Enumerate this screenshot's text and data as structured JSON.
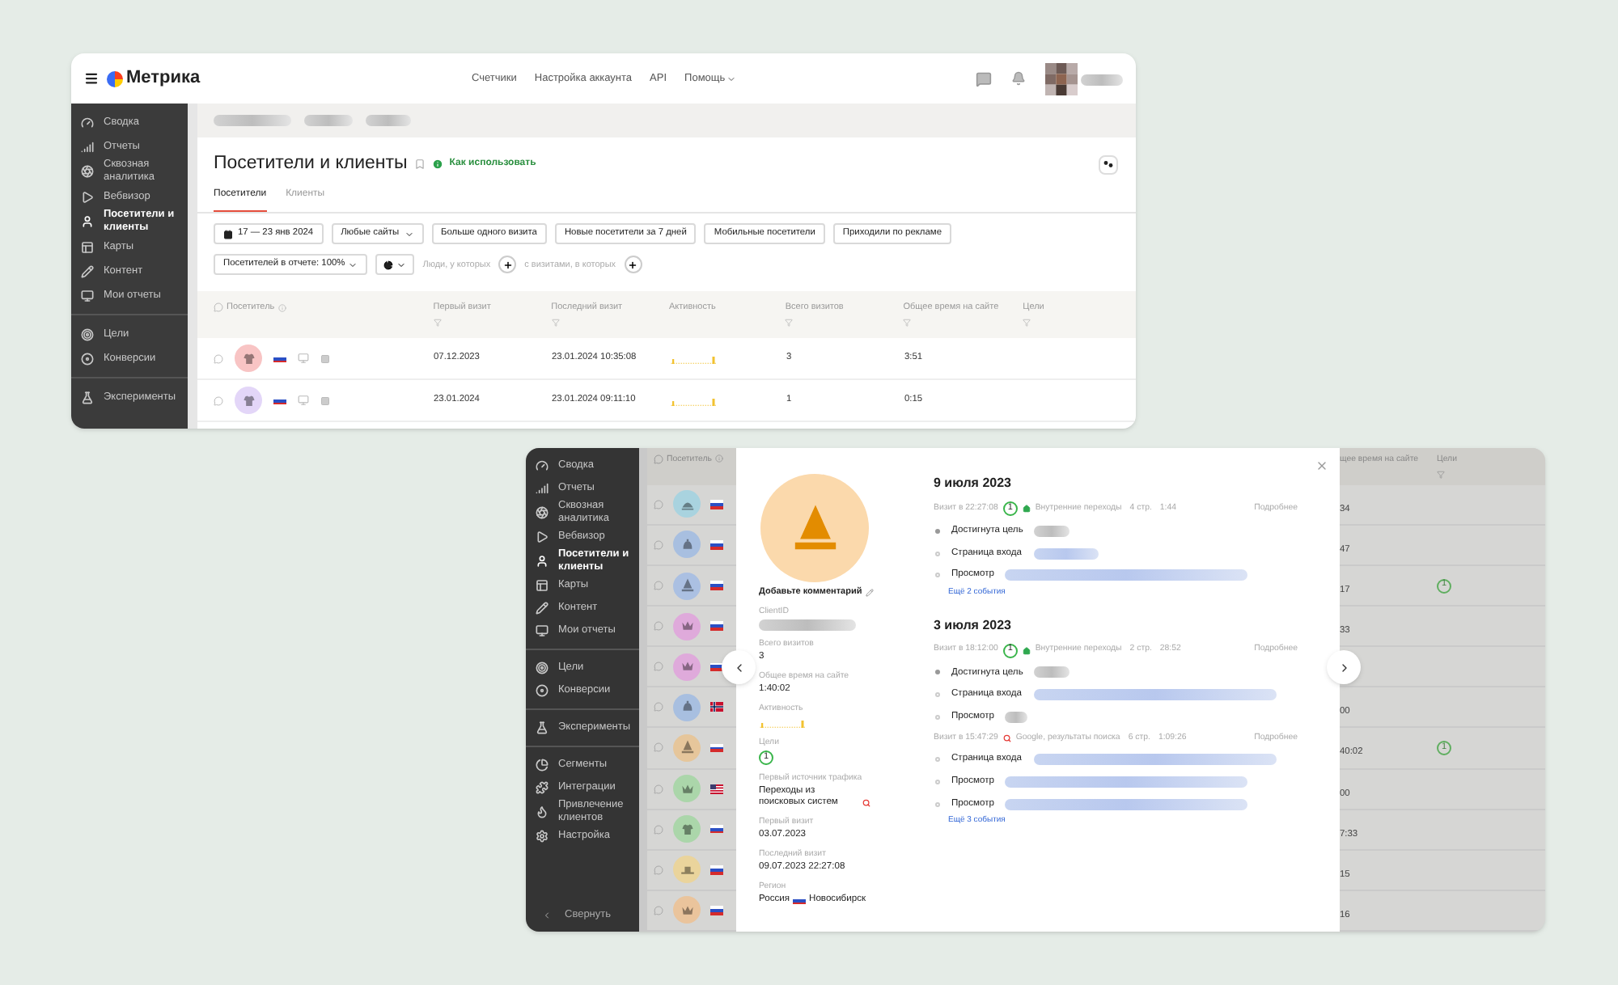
{
  "top_window": {
    "header": {
      "logo": "Метрика",
      "nav": [
        {
          "label": "Счетчики",
          "dropdown": false
        },
        {
          "label": "Настройка аккаунта",
          "dropdown": false
        },
        {
          "label": "API",
          "dropdown": false
        },
        {
          "label": "Помощь",
          "dropdown": true
        }
      ]
    },
    "sidebar": {
      "items": [
        {
          "label": "Сводка",
          "selected": false
        },
        {
          "label": "Отчеты",
          "selected": false
        },
        {
          "label": "Сквозная аналитика",
          "selected": false
        },
        {
          "label": "Вебвизор",
          "selected": false
        },
        {
          "label": "Посетители и клиенты",
          "selected": true
        },
        {
          "label": "Карты",
          "selected": false
        },
        {
          "label": "Контент",
          "selected": false
        },
        {
          "label": "Мои отчеты",
          "selected": false
        },
        {
          "label": "Цели",
          "selected": false
        },
        {
          "label": "Конверсии",
          "selected": false
        },
        {
          "label": "Эксперименты",
          "selected": false
        }
      ]
    },
    "page": {
      "title": "Посетители и клиенты",
      "help_link": "Как использовать",
      "tabs": [
        {
          "label": "Посетители",
          "selected": true
        },
        {
          "label": "Клиенты",
          "selected": false
        }
      ],
      "filters": [
        {
          "label": "17 — 23 янв 2024",
          "kind": "date"
        },
        {
          "label": "Любые сайты",
          "kind": "dropdown"
        },
        {
          "label": "Больше одного визита",
          "kind": "button"
        },
        {
          "label": "Новые посетители за 7 дней",
          "kind": "button"
        },
        {
          "label": "Мобильные посетители",
          "kind": "button"
        },
        {
          "label": "Приходили по рекламе",
          "kind": "button"
        }
      ],
      "sampling": "Посетителей в отчете: 100%",
      "condition_people": "Люди, у которых",
      "condition_visits": "с визитами, в которых"
    },
    "table": {
      "columns": [
        "Посетитель",
        "Первый визит",
        "Последний визит",
        "Активность",
        "Всего визитов",
        "Общее время на сайте",
        "Цели"
      ],
      "rows": [
        {
          "avatar": {
            "kind": "shirt",
            "color": "#f8c4c4"
          },
          "flag": {
            "kind": "ru"
          },
          "first_visit": "07.12.2023",
          "last_visit": "23.01.2024 10:35:08",
          "visits": "3",
          "time": "3:51"
        },
        {
          "avatar": {
            "kind": "shirt",
            "color": "#e3d6f8"
          },
          "flag": {
            "kind": "ru"
          },
          "first_visit": "23.01.2024",
          "last_visit": "23.01.2024 09:11:10",
          "visits": "1",
          "time": "0:15"
        }
      ]
    }
  },
  "bottom_window": {
    "sidebar": {
      "items": [
        {
          "label": "Сводка",
          "selected": false
        },
        {
          "label": "Отчеты",
          "selected": false
        },
        {
          "label": "Сквозная аналитика",
          "selected": false
        },
        {
          "label": "Вебвизор",
          "selected": false
        },
        {
          "label": "Посетители и клиенты",
          "selected": true
        },
        {
          "label": "Карты",
          "selected": false
        },
        {
          "label": "Контент",
          "selected": false
        },
        {
          "label": "Мои отчеты",
          "selected": false
        },
        {
          "label": "Цели",
          "selected": false
        },
        {
          "label": "Конверсии",
          "selected": false
        },
        {
          "label": "Эксперименты",
          "selected": false
        },
        {
          "label": "Сегменты",
          "selected": false
        },
        {
          "label": "Интеграции",
          "selected": false
        },
        {
          "label": "Привлечение клиентов",
          "selected": false
        },
        {
          "label": "Настройка",
          "selected": false
        }
      ],
      "collapse": "Свернуть"
    },
    "table": {
      "visitor_column": "Посетитель",
      "time_column": "щее время на сайте",
      "goals_column": "Цели",
      "rows": [
        {
          "avatar": {
            "kind": "cap",
            "color": "#a9d3df"
          },
          "flag": {
            "kind": "ru"
          },
          "time": "34"
        },
        {
          "avatar": {
            "kind": "bell",
            "color": "#a8bfe0"
          },
          "flag": {
            "kind": "ru"
          },
          "time": "47"
        },
        {
          "avatar": {
            "kind": "cone",
            "color": "#abc0e2"
          },
          "flag": {
            "kind": "ru"
          },
          "time": "17",
          "goals": "1"
        },
        {
          "avatar": {
            "kind": "crown",
            "color": "#dfaadb"
          },
          "flag": {
            "kind": "ru"
          },
          "time": "33"
        },
        {
          "avatar": {
            "kind": "crown",
            "color": "#dfaadb"
          },
          "flag": {
            "kind": "ru"
          }
        },
        {
          "avatar": {
            "kind": "bell",
            "color": "#a8bfe0"
          },
          "flag": {
            "kind": "no"
          },
          "time": "00"
        },
        {
          "avatar": {
            "kind": "cone",
            "color": "#e6c69b"
          },
          "flag": {
            "kind": "ru"
          },
          "time": "40:02",
          "goals": "1"
        },
        {
          "avatar": {
            "kind": "crown",
            "color": "#abd6aa"
          },
          "flag": {
            "kind": "us"
          },
          "time": "00"
        },
        {
          "avatar": {
            "kind": "shirt",
            "color": "#abd6aa"
          },
          "flag": {
            "kind": "ru"
          },
          "time": "7:33"
        },
        {
          "avatar": {
            "kind": "hat",
            "color": "#ead49c"
          },
          "flag": {
            "kind": "ru"
          },
          "time": "15"
        },
        {
          "avatar": {
            "kind": "crown",
            "color": "#eac49c"
          },
          "flag": {
            "kind": "ru"
          },
          "time": "16"
        }
      ]
    },
    "visitor_card": {
      "avatar": {
        "kind": "cone",
        "color": "#fbd9ac"
      },
      "comment": "Добавьте комментарий",
      "fields": [
        {
          "label": "ClientID",
          "kind": "blurred"
        },
        {
          "label": "Всего визитов",
          "value": "3",
          "kind": "text"
        },
        {
          "label": "Общее время на сайте",
          "value": "1:40:02",
          "kind": "text"
        },
        {
          "label": "Активность",
          "kind": "activity"
        },
        {
          "label": "Цели",
          "value": "1",
          "kind": "goals"
        },
        {
          "label": "Первый источник трафика",
          "value": "Переходы из поисковых систем",
          "kind": "search"
        },
        {
          "label": "Первый визит",
          "value": "03.07.2023",
          "kind": "text"
        },
        {
          "label": "Последний визит",
          "value": "09.07.2023 22:27:08",
          "kind": "text"
        },
        {
          "label": "Регион",
          "value": "Россия",
          "value2": "Новосибирск",
          "kind": "region"
        }
      ],
      "days": [
        {
          "date": "9 июля 2023",
          "visits": [
            {
              "time": "Визит в 22:27:08",
              "goals": "1",
              "kind": "internal",
              "source": "Внутренние переходы",
              "pages": "4 стр.",
              "duration": "1:44",
              "details": "Подробнее",
              "events": [
                {
                  "label": "Достигнута цель",
                  "kind": "goal"
                },
                {
                  "label": "Страница входа",
                  "kind": "page"
                },
                {
                  "label": "Просмотр",
                  "kind": "page"
                }
              ],
              "more": "Ещё 2 события"
            }
          ]
        },
        {
          "date": "3 июля 2023",
          "visits": [
            {
              "time": "Визит в 18:12:00",
              "goals": "1",
              "kind": "internal",
              "source": "Внутренние переходы",
              "pages": "2 стр.",
              "duration": "28:52",
              "details": "Подробнее",
              "events": [
                {
                  "label": "Достигнута цель",
                  "kind": "goal"
                },
                {
                  "label": "Страница входа",
                  "kind": "page"
                },
                {
                  "label": "Просмотр",
                  "kind": "short"
                }
              ]
            },
            {
              "time": "Визит в 15:47:29",
              "kind": "search",
              "source": "Google, результаты поиска",
              "pages": "6 стр.",
              "duration": "1:09:26",
              "details": "Подробнее",
              "events": [
                {
                  "label": "Страница входа",
                  "kind": "page"
                },
                {
                  "label": "Просмотр",
                  "kind": "page"
                },
                {
                  "label": "Просмотр",
                  "kind": "page"
                }
              ],
              "more": "Ещё 3 события"
            }
          ]
        }
      ]
    }
  }
}
